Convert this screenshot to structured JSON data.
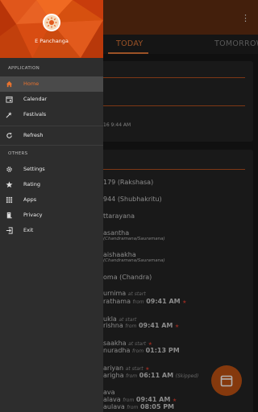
{
  "app": {
    "title": "E Panchanga",
    "overflow_icon": "more-vert-icon",
    "accent_color": "#e8732f",
    "header_color": "#d2440e"
  },
  "tabs": [
    {
      "label": "TODAY",
      "selected": true
    },
    {
      "label": "TOMORROW",
      "selected": false
    }
  ],
  "drawer": {
    "section_application": "APPLICATION",
    "section_others": "OTHERS",
    "items_application": [
      {
        "label": "Home",
        "icon": "home-icon",
        "active": true
      },
      {
        "label": "Calendar",
        "icon": "calendar-icon"
      },
      {
        "label": "Festivals",
        "icon": "festival-icon"
      },
      {
        "label": "Refresh",
        "icon": "refresh-icon"
      }
    ],
    "items_others": [
      {
        "label": "Settings",
        "icon": "gear-icon"
      },
      {
        "label": "Rating",
        "icon": "star-icon"
      },
      {
        "label": "Apps",
        "icon": "apps-grid-icon"
      },
      {
        "label": "Privacy",
        "icon": "privacy-icon"
      },
      {
        "label": "Exit",
        "icon": "exit-icon"
      }
    ]
  },
  "background_rows": {
    "card1_line": "16  9:44 AM",
    "rows": [
      "179 (Rakshasa)",
      "944 (Shubhakritu)",
      "ttarayana",
      "asantha",
      "(Chandramana/Sauramana)",
      "aishaakha",
      "(Chandramana/Sauramana)",
      "oma (Chandra)"
    ],
    "tithi": {
      "label1": "urnima",
      "tag1": "at start",
      "label2": "rathama",
      "from": "from",
      "time": "09:41 AM"
    },
    "paksha": {
      "label1": "ukla",
      "tag1": "at start",
      "label2": "rishna",
      "from": "from",
      "time": "09:41 AM"
    },
    "nakshatra": {
      "label1": "saakha",
      "tag1": "at start",
      "label2": "nuradha",
      "from": "from",
      "time": "01:13 PM"
    },
    "yoga": {
      "label1": "ariyan",
      "tag1": "at start",
      "label2": "arigha",
      "from": "from",
      "time": "06:11 AM",
      "note": "(Skipped)"
    },
    "karana": {
      "label1": "ava",
      "label2": "alava",
      "label3": "aulava",
      "from": "from",
      "time1": "09:41 AM",
      "time2": "08:05 PM"
    }
  }
}
